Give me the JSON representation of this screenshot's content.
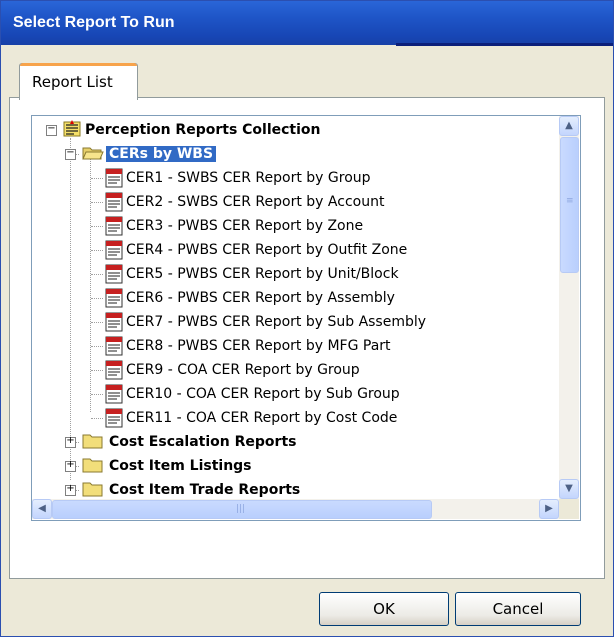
{
  "window": {
    "title": "Select Report To Run"
  },
  "tabs": [
    {
      "label": "Report List"
    }
  ],
  "tree": {
    "root": {
      "label": "Perception Reports Collection",
      "state": "expanded"
    },
    "folders": [
      {
        "label": "CERs by WBS",
        "state": "expanded",
        "selected": true,
        "items": [
          "CER1 - SWBS CER Report by Group",
          "CER2 - SWBS CER Report by Account",
          "CER3 - PWBS CER Report by Zone",
          "CER4 - PWBS CER Report by Outfit Zone",
          "CER5 - PWBS CER Report by Unit/Block",
          "CER6 - PWBS CER Report by Assembly",
          "CER7 - PWBS CER Report by Sub Assembly",
          "CER8 - PWBS CER Report by MFG Part",
          "CER9 - COA CER Report by Group",
          "CER10 - COA CER Report by Sub Group",
          "CER11 - COA CER Report by Cost Code"
        ]
      },
      {
        "label": "Cost Escalation Reports",
        "state": "collapsed"
      },
      {
        "label": "Cost Item Listings",
        "state": "collapsed"
      },
      {
        "label": "Cost Item Trade Reports",
        "state": "collapsed"
      }
    ]
  },
  "buttons": {
    "ok": "OK",
    "cancel": "Cancel"
  },
  "colors": {
    "titlebar": "#1F56C8",
    "selection": "#316AC5",
    "tab_accent": "#F7A34B",
    "dialog_bg": "#ECE9D8"
  }
}
